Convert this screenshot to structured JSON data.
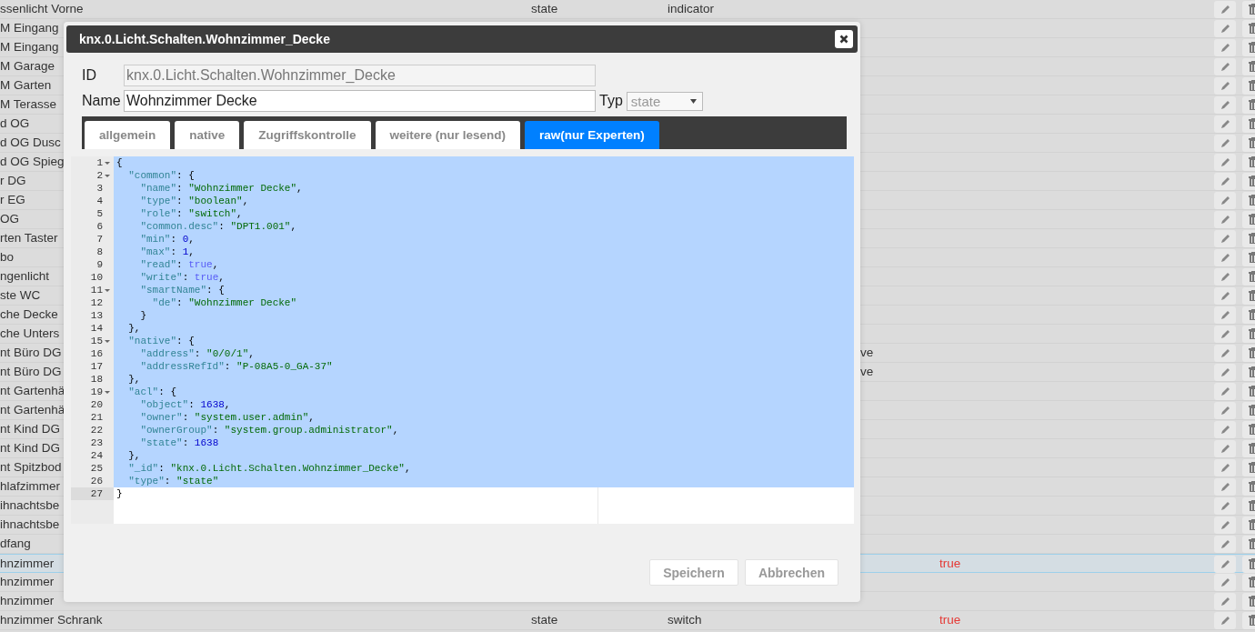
{
  "table": {
    "rows": [
      {
        "column_1": "ssenlicht Vorne",
        "column_2": "state",
        "column_3": "indicator",
        "selected": false
      },
      {
        "column_1": "M Eingang",
        "selected": false
      },
      {
        "column_1": "M Eingang",
        "selected": false
      },
      {
        "column_1": "M Garage",
        "selected": false
      },
      {
        "column_1": "M Garten",
        "selected": false
      },
      {
        "column_1": "M Terasse",
        "selected": false
      },
      {
        "column_1": "d OG",
        "selected": false
      },
      {
        "column_1": "d OG Dusc",
        "selected": false
      },
      {
        "column_1": "d OG Spieg",
        "selected": false
      },
      {
        "column_1": "r DG",
        "selected": false
      },
      {
        "column_1": "r EG",
        "selected": false
      },
      {
        "column_1": "OG",
        "selected": false
      },
      {
        "column_1": "rten Taster",
        "selected": false
      },
      {
        "column_1": "bo",
        "selected": false
      },
      {
        "column_1": "ngenlicht",
        "selected": false
      },
      {
        "column_1": "ste WC",
        "selected": false
      },
      {
        "column_1": "che Decke",
        "selected": false
      },
      {
        "column_1": "che Unters",
        "selected": false
      },
      {
        "column_1": "nt Büro DG",
        "column_4": "ve",
        "selected": false
      },
      {
        "column_1": "nt Büro DG",
        "column_4": "ve",
        "selected": false
      },
      {
        "column_1": "nt Gartenhä",
        "selected": false
      },
      {
        "column_1": "nt Gartenhä",
        "selected": false
      },
      {
        "column_1": "nt Kind DG",
        "selected": false
      },
      {
        "column_1": "nt Kind DG",
        "selected": false
      },
      {
        "column_1": "nt Spitzbod",
        "selected": false
      },
      {
        "column_1": "hlafzimmer",
        "selected": false
      },
      {
        "column_1": "ihnachtsbe",
        "selected": false
      },
      {
        "column_1": "ihnachtsbe",
        "selected": false
      },
      {
        "column_1": "dfang",
        "selected": false
      },
      {
        "column_1": "hnzimmer",
        "column_5": "true",
        "selected": true
      },
      {
        "column_1": "hnzimmer",
        "selected": false
      },
      {
        "column_1": "hnzimmer",
        "selected": false
      },
      {
        "column_1": "hnzimmer Schrank",
        "column_2": "state",
        "column_3": "switch",
        "column_5": "true",
        "selected": false
      }
    ]
  },
  "dialog": {
    "title": "knx.0.Licht.Schalten.Wohnzimmer_Decke",
    "id_label": "ID",
    "id_value": "knx.0.Licht.Schalten.Wohnzimmer_Decke",
    "name_label": "Name",
    "name_value": "Wohnzimmer Decke",
    "type_label": "Typ",
    "type_value": "state",
    "type_disabled": true,
    "tabs": [
      {
        "label": "allgemein",
        "selected": false
      },
      {
        "label": "native",
        "selected": false
      },
      {
        "label": "Zugriffskontrolle",
        "selected": false
      },
      {
        "label": "weitere (nur lesend)",
        "selected": false
      },
      {
        "label": "raw(nur Experten)",
        "selected": true
      }
    ],
    "editor": {
      "lines": [
        {
          "n": "1",
          "fold": true,
          "selected": true,
          "text": "{"
        },
        {
          "n": "2",
          "fold": true,
          "selected": true,
          "text": "  \"common\": {"
        },
        {
          "n": "3",
          "fold": false,
          "selected": true,
          "text": "    \"name\": \"Wohnzimmer Decke\","
        },
        {
          "n": "4",
          "fold": false,
          "selected": true,
          "text": "    \"type\": \"boolean\","
        },
        {
          "n": "5",
          "fold": false,
          "selected": true,
          "text": "    \"role\": \"switch\","
        },
        {
          "n": "6",
          "fold": false,
          "selected": true,
          "text": "    \"common.desc\": \"DPT1.001\","
        },
        {
          "n": "7",
          "fold": false,
          "selected": true,
          "text": "    \"min\": 0,"
        },
        {
          "n": "8",
          "fold": false,
          "selected": true,
          "text": "    \"max\": 1,"
        },
        {
          "n": "9",
          "fold": false,
          "selected": true,
          "text": "    \"read\": true,"
        },
        {
          "n": "10",
          "fold": false,
          "selected": true,
          "text": "    \"write\": true,"
        },
        {
          "n": "11",
          "fold": true,
          "selected": true,
          "text": "    \"smartName\": {"
        },
        {
          "n": "12",
          "fold": false,
          "selected": true,
          "text": "      \"de\": \"Wohnzimmer Decke\""
        },
        {
          "n": "13",
          "fold": false,
          "selected": true,
          "text": "    }"
        },
        {
          "n": "14",
          "fold": false,
          "selected": true,
          "text": "  },"
        },
        {
          "n": "15",
          "fold": true,
          "selected": true,
          "text": "  \"native\": {"
        },
        {
          "n": "16",
          "fold": false,
          "selected": true,
          "text": "    \"address\": \"0/0/1\","
        },
        {
          "n": "17",
          "fold": false,
          "selected": true,
          "text": "    \"addressRefId\": \"P-08A5-0_GA-37\""
        },
        {
          "n": "18",
          "fold": false,
          "selected": true,
          "text": "  },"
        },
        {
          "n": "19",
          "fold": true,
          "selected": true,
          "text": "  \"acl\": {"
        },
        {
          "n": "20",
          "fold": false,
          "selected": true,
          "text": "    \"object\": 1638,"
        },
        {
          "n": "21",
          "fold": false,
          "selected": true,
          "text": "    \"owner\": \"system.user.admin\","
        },
        {
          "n": "22",
          "fold": false,
          "selected": true,
          "text": "    \"ownerGroup\": \"system.group.administrator\","
        },
        {
          "n": "23",
          "fold": false,
          "selected": true,
          "text": "    \"state\": 1638"
        },
        {
          "n": "24",
          "fold": false,
          "selected": true,
          "text": "  },"
        },
        {
          "n": "25",
          "fold": false,
          "selected": true,
          "text": "  \"_id\": \"knx.0.Licht.Schalten.Wohnzimmer_Decke\","
        },
        {
          "n": "26",
          "fold": false,
          "selected": true,
          "text": "  \"type\": \"state\""
        },
        {
          "n": "27",
          "fold": false,
          "selected": false,
          "text": "}"
        }
      ]
    },
    "buttons": [
      "Speichern",
      "Abbrechen"
    ]
  }
}
